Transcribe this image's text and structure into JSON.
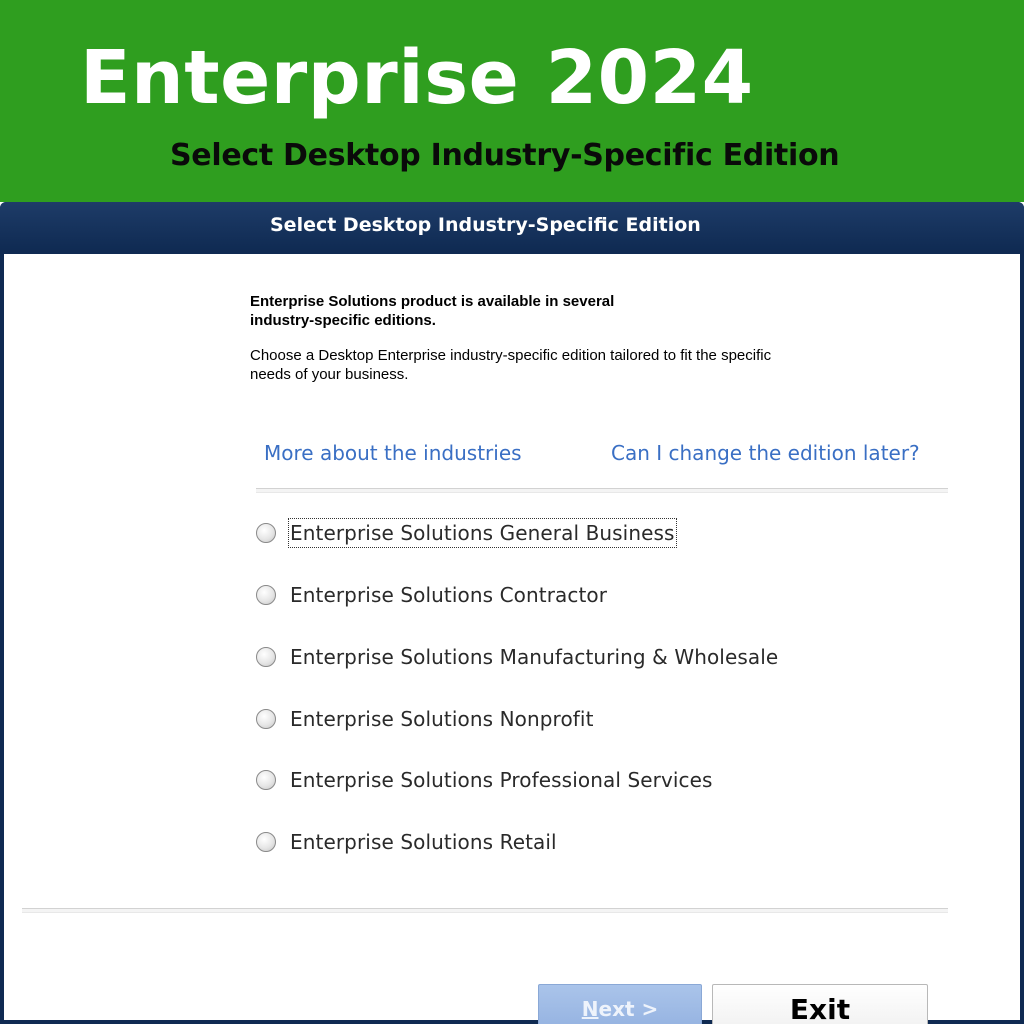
{
  "banner": {
    "title": "Enterprise 2024",
    "subtitle": "Select  Desktop Industry-Specific Edition",
    "background_color": "#2f9e1f"
  },
  "window": {
    "title": "Select  Desktop Industry-Specific Edition",
    "intro_bold": "Enterprise Solutions product is available in several industry-specific editions.",
    "intro_text": "Choose a Desktop Enterprise  industry-specific edition tailored to fit the specific needs of your business.",
    "links": {
      "industries": "More about the industries",
      "change_edition": "Can I change the edition later?"
    },
    "options": [
      {
        "label": "Enterprise Solutions General Business",
        "selected": false,
        "focused": true
      },
      {
        "label": "Enterprise Solutions Contractor",
        "selected": false
      },
      {
        "label": "Enterprise Solutions Manufacturing & Wholesale",
        "selected": false
      },
      {
        "label": "Enterprise Solutions Nonprofit",
        "selected": false
      },
      {
        "label": "Enterprise Solutions Professional Services",
        "selected": false
      },
      {
        "label": "Enterprise Solutions Retail",
        "selected": false
      }
    ],
    "buttons": {
      "next_mnemonic": "N",
      "next_rest": "ext >",
      "next_disabled": true,
      "exit": "Exit"
    },
    "link_color": "#3a6fc4",
    "title_bar_color": "#0f2a52"
  }
}
